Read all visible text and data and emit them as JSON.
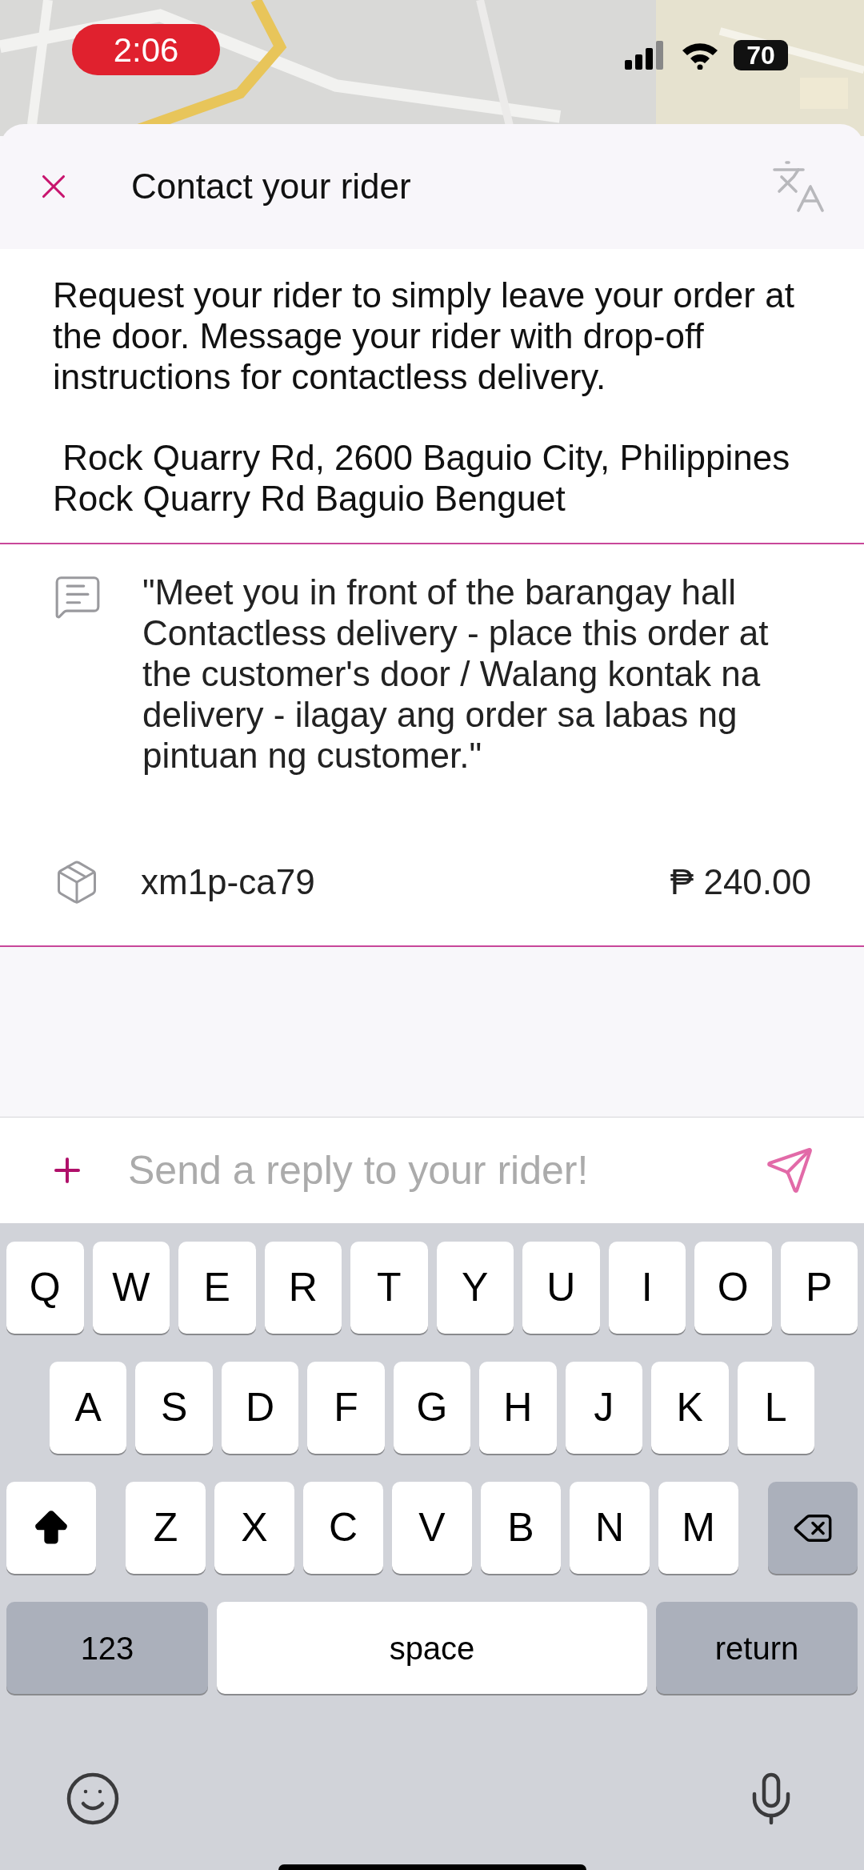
{
  "status_bar": {
    "time": "2:06",
    "battery": "70"
  },
  "header": {
    "title": "Contact your rider"
  },
  "instructions": "Request your rider to simply leave your order at the door. Message your rider with drop-off instructions for contactless delivery.",
  "address": [
    " Rock Quarry Rd, 2600 Baguio City, Philippines",
    "Rock Quarry Rd Baguio Benguet"
  ],
  "message": "\"Meet you in front of the barangay hall\n Contactless delivery - place this order at the customer's door / Walang kontak na delivery - ilagay ang order sa labas ng pintuan ng customer.\"",
  "order": {
    "code": "xm1p-ca79",
    "price": "₱ 240.00"
  },
  "reply": {
    "placeholder": "Send a reply to your rider!"
  },
  "keyboard": {
    "rows": [
      {
        "keys": [
          {
            "kind": "letter",
            "label": "Q"
          },
          {
            "kind": "letter",
            "label": "W"
          },
          {
            "kind": "letter",
            "label": "E"
          },
          {
            "kind": "letter",
            "label": "R"
          },
          {
            "kind": "letter",
            "label": "T"
          },
          {
            "kind": "letter",
            "label": "Y"
          },
          {
            "kind": "letter",
            "label": "U"
          },
          {
            "kind": "letter",
            "label": "I"
          },
          {
            "kind": "letter",
            "label": "O"
          },
          {
            "kind": "letter",
            "label": "P"
          }
        ]
      },
      {
        "keys": [
          {
            "kind": "letter",
            "label": "A"
          },
          {
            "kind": "letter",
            "label": "S"
          },
          {
            "kind": "letter",
            "label": "D"
          },
          {
            "kind": "letter",
            "label": "F"
          },
          {
            "kind": "letter",
            "label": "G"
          },
          {
            "kind": "letter",
            "label": "H"
          },
          {
            "kind": "letter",
            "label": "J"
          },
          {
            "kind": "letter",
            "label": "K"
          },
          {
            "kind": "letter",
            "label": "L"
          }
        ]
      },
      {
        "keys": [
          {
            "kind": "shift"
          },
          {
            "kind": "letter",
            "label": "Z"
          },
          {
            "kind": "letter",
            "label": "X"
          },
          {
            "kind": "letter",
            "label": "C"
          },
          {
            "kind": "letter",
            "label": "V"
          },
          {
            "kind": "letter",
            "label": "B"
          },
          {
            "kind": "letter",
            "label": "N"
          },
          {
            "kind": "letter",
            "label": "M"
          },
          {
            "kind": "backspace"
          }
        ]
      },
      {
        "keys": [
          {
            "kind": "mode",
            "label": "123"
          },
          {
            "kind": "space",
            "label": "space"
          },
          {
            "kind": "mode",
            "label": "return"
          }
        ]
      }
    ]
  }
}
